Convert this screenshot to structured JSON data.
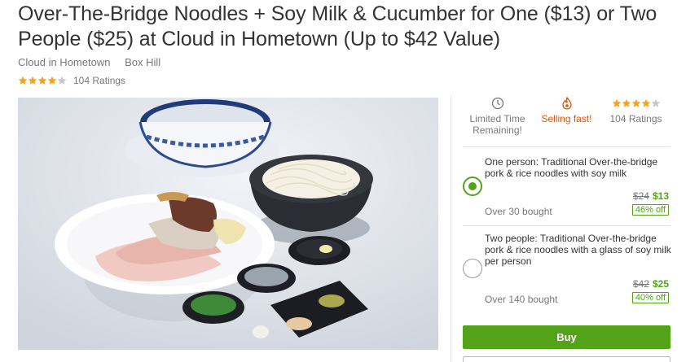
{
  "deal": {
    "title": "Over-The-Bridge Noodles + Soy Milk & Cucumber for One ($13) or Two People ($25) at Cloud in Hometown (Up to $42 Value)",
    "merchant": "Cloud in Hometown",
    "location": "Box Hill",
    "rating_stars": 4,
    "rating_max": 5,
    "ratings_text": "104 Ratings"
  },
  "stats": {
    "limited_time": "Limited Time Remaining!",
    "selling_fast": "Selling fast!",
    "ratings_text": "104 Ratings"
  },
  "options": [
    {
      "title": "One person: Traditional Over-the-bridge pork & rice noodles with soy milk",
      "old_price": "$24",
      "new_price": "$13",
      "bought": "Over 30 bought",
      "discount": "46% off",
      "selected": true
    },
    {
      "title": "Two people: Traditional Over-the-bridge pork & rice noodles with a glass of soy milk per person",
      "old_price": "$42",
      "new_price": "$25",
      "bought": "Over 140 bought",
      "discount": "40% off",
      "selected": false
    }
  ],
  "buy_label": "Buy",
  "colors": {
    "accent_green": "#53a318",
    "star_gold": "#f2a51a",
    "selling_fast": "#e35205",
    "muted": "#75787b"
  },
  "icons": {
    "clock": "clock-icon",
    "flame": "flame-icon",
    "star": "star-icon"
  }
}
